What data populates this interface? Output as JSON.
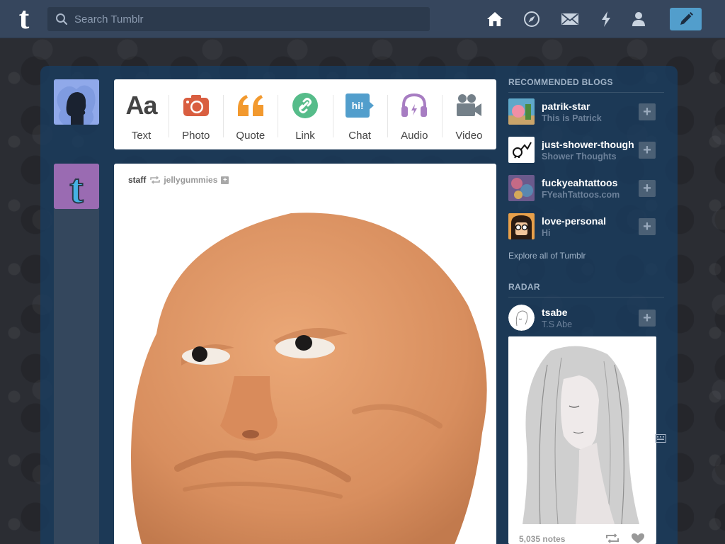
{
  "header": {
    "logo": "t",
    "search_placeholder": "Search Tumblr",
    "icons": [
      "home-icon",
      "compass-icon",
      "mail-icon",
      "lightning-icon",
      "account-icon",
      "pencil-icon"
    ]
  },
  "post_types": [
    {
      "label": "Text",
      "icon": "text-icon",
      "glyph": "Aa",
      "color": "#444444"
    },
    {
      "label": "Photo",
      "icon": "camera-icon",
      "color": "#d95e40"
    },
    {
      "label": "Quote",
      "icon": "quote-icon",
      "color": "#f2992e"
    },
    {
      "label": "Link",
      "icon": "link-icon",
      "color": "#56bc8a"
    },
    {
      "label": "Chat",
      "icon": "chat-icon",
      "glyph": "hi!",
      "color": "#529ecc"
    },
    {
      "label": "Audio",
      "icon": "headphones-icon",
      "color": "#a77dc2"
    },
    {
      "label": "Video",
      "icon": "video-camera-icon",
      "color": "#748089"
    }
  ],
  "post": {
    "author": "staff",
    "reblogged_from": "jellygummies",
    "follow_glyph": "+"
  },
  "sidebar": {
    "recommended_heading": "RECOMMENDED BLOGS",
    "blogs": [
      {
        "name": "patrik-star",
        "title": "This is Patrick",
        "follow_glyph": "+"
      },
      {
        "name": "just-shower-thoughts",
        "title": "Shower Thoughts",
        "follow_glyph": "+"
      },
      {
        "name": "fuckyeahtattoos",
        "title": "FYeahTattoos.com",
        "follow_glyph": "+"
      },
      {
        "name": "love-personal",
        "title": "Hi",
        "follow_glyph": "+"
      }
    ],
    "explore_link": "Explore all of Tumblr",
    "radar_heading": "RADAR",
    "radar": {
      "name": "tsabe",
      "title": "T.S Abe",
      "follow_glyph": "+",
      "notes": "5,035 notes"
    }
  },
  "colors": {
    "header": "#36465d",
    "accent": "#529ecc",
    "panel": "#1a3c5e"
  }
}
